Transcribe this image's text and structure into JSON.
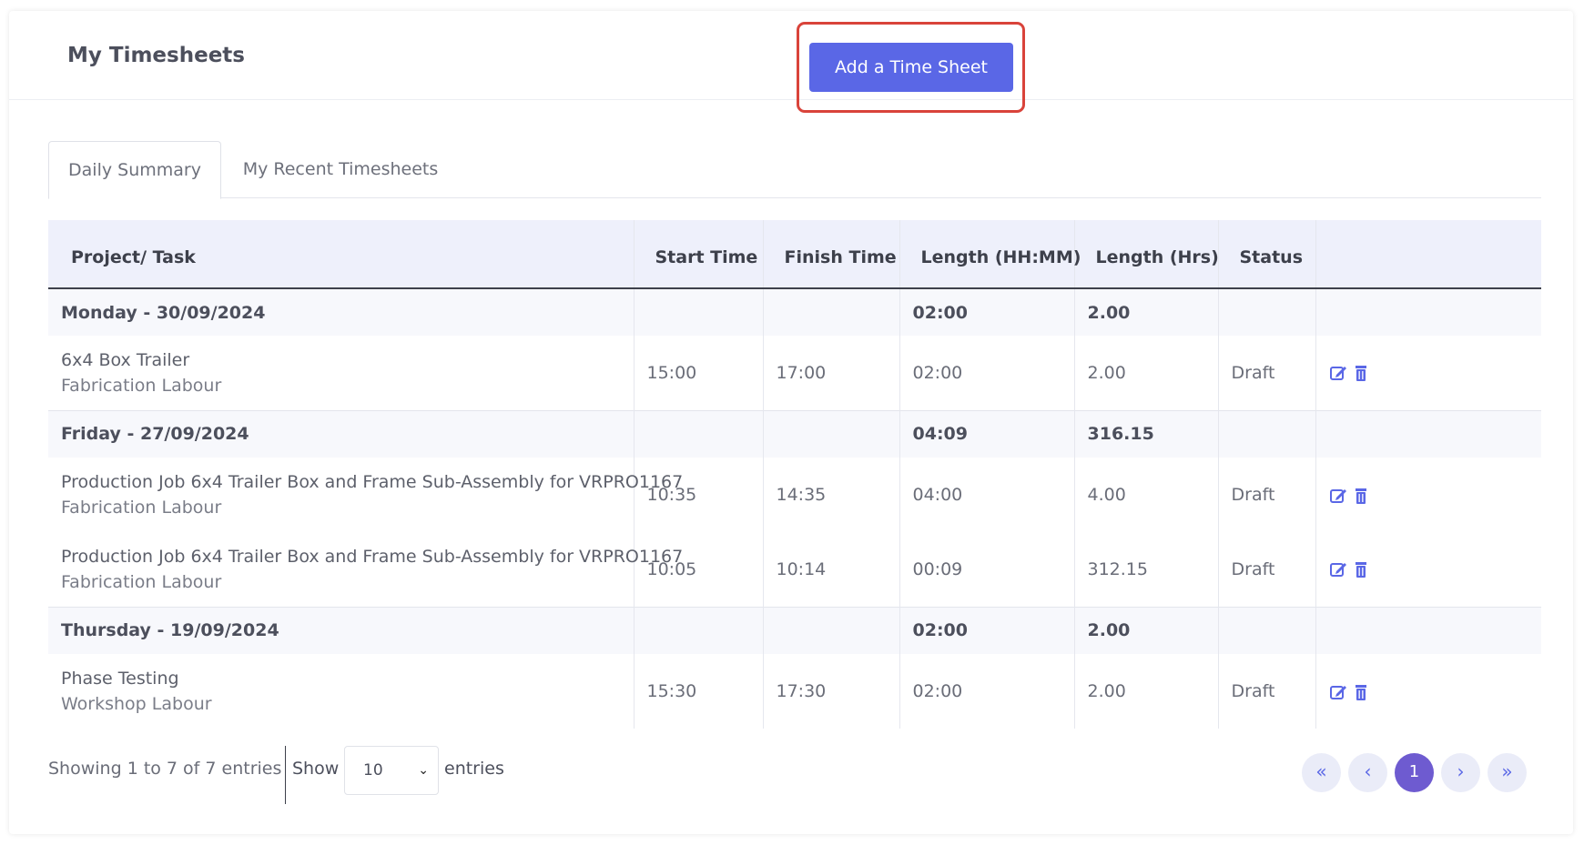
{
  "header": {
    "title": "My Timesheets",
    "add_button_label": "Add a Time Sheet"
  },
  "tabs": [
    {
      "label": "Daily Summary",
      "active": true
    },
    {
      "label": "My Recent Timesheets",
      "active": false
    }
  ],
  "table": {
    "columns": [
      "Project/ Task",
      "Start Time",
      "Finish Time",
      "Length (HH:MM)",
      "Length (Hrs)",
      "Status"
    ],
    "groups": [
      {
        "day": "Monday - 30/09/2024",
        "total_hhmm": "02:00",
        "total_hrs": "2.00",
        "entries": [
          {
            "project": "6x4 Box Trailer",
            "task": "Fabrication Labour",
            "start": "15:00",
            "finish": "17:00",
            "length_hhmm": "02:00",
            "length_hrs": "2.00",
            "status": "Draft"
          }
        ]
      },
      {
        "day": "Friday - 27/09/2024",
        "total_hhmm": "04:09",
        "total_hrs": "316.15",
        "entries": [
          {
            "project": "Production Job 6x4 Trailer Box and Frame Sub-Assembly for VRPRO1167",
            "task": "Fabrication Labour",
            "start": "10:35",
            "finish": "14:35",
            "length_hhmm": "04:00",
            "length_hrs": "4.00",
            "status": "Draft"
          },
          {
            "project": "Production Job 6x4 Trailer Box and Frame Sub-Assembly for VRPRO1167",
            "task": "Fabrication Labour",
            "start": "10:05",
            "finish": "10:14",
            "length_hhmm": "00:09",
            "length_hrs": "312.15",
            "status": "Draft"
          }
        ]
      },
      {
        "day": "Thursday - 19/09/2024",
        "total_hhmm": "02:00",
        "total_hrs": "2.00",
        "entries": [
          {
            "project": "Phase Testing",
            "task": "Workshop Labour",
            "start": "15:30",
            "finish": "17:30",
            "length_hhmm": "02:00",
            "length_hrs": "2.00",
            "status": "Draft"
          }
        ]
      }
    ]
  },
  "footer": {
    "info": "Showing 1 to 7 of 7 entries",
    "show_label": "Show",
    "page_size": "10",
    "entries_label": "entries",
    "pagination": {
      "first": "«",
      "prev": "‹",
      "current": "1",
      "next": "›",
      "last": "»"
    }
  },
  "colors": {
    "accent": "#5a67e6",
    "active_page": "#6e5bd0",
    "highlight_border": "#d9433a"
  },
  "icons": {
    "edit": "edit-icon",
    "delete": "trash-icon"
  }
}
